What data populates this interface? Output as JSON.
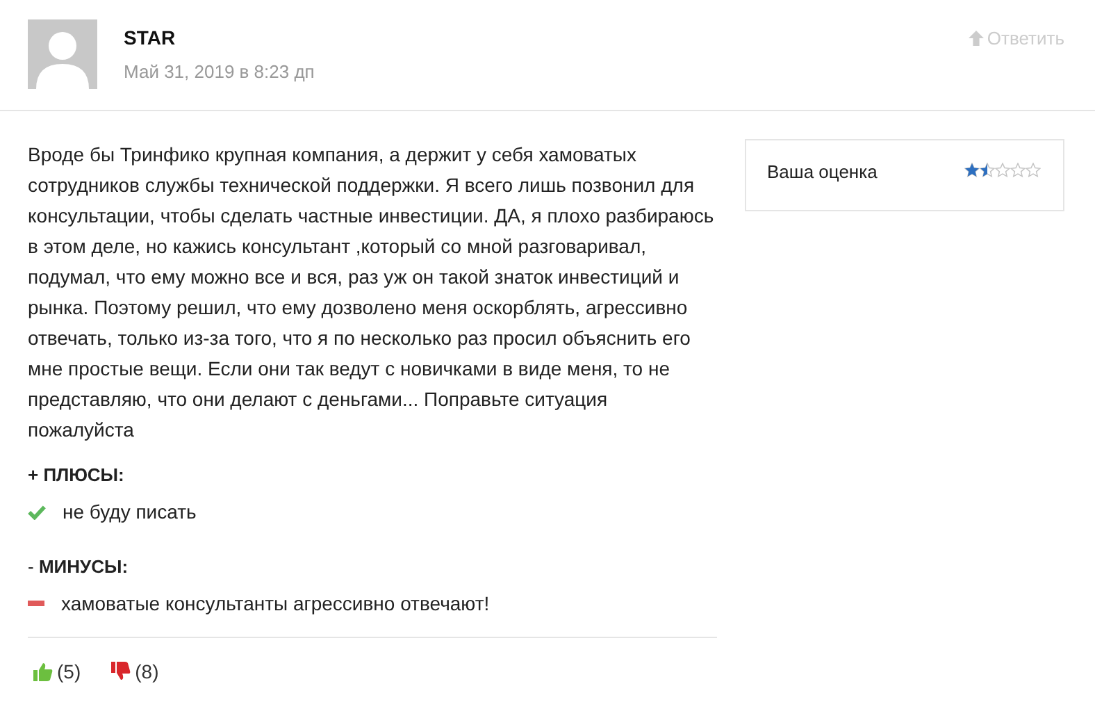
{
  "author": {
    "name": "STAR",
    "date": "Май 31, 2019 в 8:23 дп"
  },
  "reply": {
    "label": "Ответить"
  },
  "review": {
    "text": "Вроде бы Тринфико крупная компания, а держит у себя хамоватых сотрудников службы технической поддержки. Я всего лишь позвонил для консультации, чтобы сделать частные инвестиции. ДА, я плохо разбираюсь в этом деле, но кажись консультант ,который со мной разговаривал, подумал, что ему можно все и вся, раз уж он такой знаток инвестиций и рынка. Поэтому решил, что ему дозволено меня оскорблять, агрессивно отвечать, только из-за того, что я по несколько раз просил объяснить его мне простые вещи. Если они так ведут с новичками в виде меня, то не представляю, что они делают с деньгами... Поправьте ситуация пожалуйста"
  },
  "sections": [
    {
      "kind": "pros",
      "title": "**+ ПЛЮСЫ:**",
      "items": [
        "не буду писать"
      ]
    },
    {
      "kind": "cons",
      "title": "- **МИНУСЫ:**",
      "items": [
        "хамоватые консультанты агрессивно отвечают!"
      ]
    }
  ],
  "rating": {
    "label": "Ваша оценка",
    "stars": 1.5
  },
  "votes": [
    {
      "kind": "up",
      "count": "(5)"
    },
    {
      "kind": "down",
      "count": "(8)"
    }
  ]
}
